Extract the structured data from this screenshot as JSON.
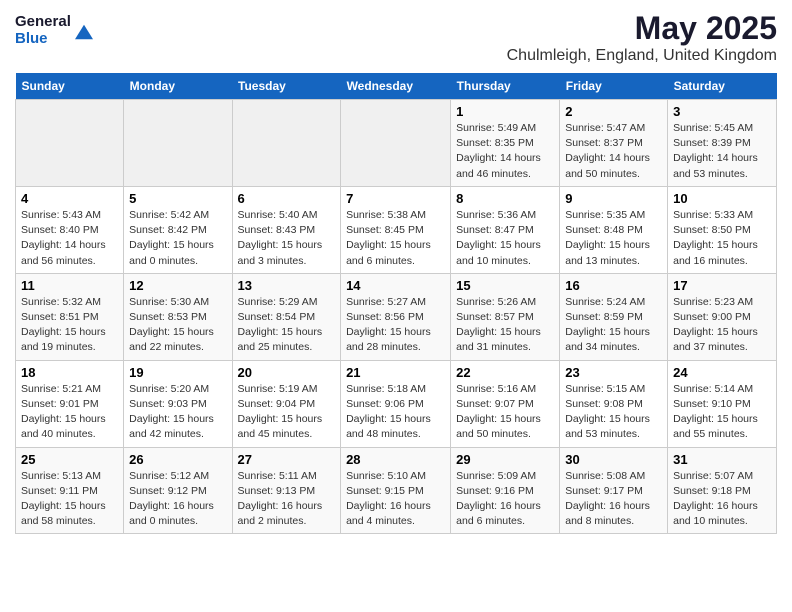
{
  "header": {
    "logo_general": "General",
    "logo_blue": "Blue",
    "title": "May 2025",
    "subtitle": "Chulmleigh, England, United Kingdom"
  },
  "calendar": {
    "days_of_week": [
      "Sunday",
      "Monday",
      "Tuesday",
      "Wednesday",
      "Thursday",
      "Friday",
      "Saturday"
    ],
    "weeks": [
      [
        {
          "day": "",
          "info": ""
        },
        {
          "day": "",
          "info": ""
        },
        {
          "day": "",
          "info": ""
        },
        {
          "day": "",
          "info": ""
        },
        {
          "day": "1",
          "info": "Sunrise: 5:49 AM\nSunset: 8:35 PM\nDaylight: 14 hours\nand 46 minutes."
        },
        {
          "day": "2",
          "info": "Sunrise: 5:47 AM\nSunset: 8:37 PM\nDaylight: 14 hours\nand 50 minutes."
        },
        {
          "day": "3",
          "info": "Sunrise: 5:45 AM\nSunset: 8:39 PM\nDaylight: 14 hours\nand 53 minutes."
        }
      ],
      [
        {
          "day": "4",
          "info": "Sunrise: 5:43 AM\nSunset: 8:40 PM\nDaylight: 14 hours\nand 56 minutes."
        },
        {
          "day": "5",
          "info": "Sunrise: 5:42 AM\nSunset: 8:42 PM\nDaylight: 15 hours\nand 0 minutes."
        },
        {
          "day": "6",
          "info": "Sunrise: 5:40 AM\nSunset: 8:43 PM\nDaylight: 15 hours\nand 3 minutes."
        },
        {
          "day": "7",
          "info": "Sunrise: 5:38 AM\nSunset: 8:45 PM\nDaylight: 15 hours\nand 6 minutes."
        },
        {
          "day": "8",
          "info": "Sunrise: 5:36 AM\nSunset: 8:47 PM\nDaylight: 15 hours\nand 10 minutes."
        },
        {
          "day": "9",
          "info": "Sunrise: 5:35 AM\nSunset: 8:48 PM\nDaylight: 15 hours\nand 13 minutes."
        },
        {
          "day": "10",
          "info": "Sunrise: 5:33 AM\nSunset: 8:50 PM\nDaylight: 15 hours\nand 16 minutes."
        }
      ],
      [
        {
          "day": "11",
          "info": "Sunrise: 5:32 AM\nSunset: 8:51 PM\nDaylight: 15 hours\nand 19 minutes."
        },
        {
          "day": "12",
          "info": "Sunrise: 5:30 AM\nSunset: 8:53 PM\nDaylight: 15 hours\nand 22 minutes."
        },
        {
          "day": "13",
          "info": "Sunrise: 5:29 AM\nSunset: 8:54 PM\nDaylight: 15 hours\nand 25 minutes."
        },
        {
          "day": "14",
          "info": "Sunrise: 5:27 AM\nSunset: 8:56 PM\nDaylight: 15 hours\nand 28 minutes."
        },
        {
          "day": "15",
          "info": "Sunrise: 5:26 AM\nSunset: 8:57 PM\nDaylight: 15 hours\nand 31 minutes."
        },
        {
          "day": "16",
          "info": "Sunrise: 5:24 AM\nSunset: 8:59 PM\nDaylight: 15 hours\nand 34 minutes."
        },
        {
          "day": "17",
          "info": "Sunrise: 5:23 AM\nSunset: 9:00 PM\nDaylight: 15 hours\nand 37 minutes."
        }
      ],
      [
        {
          "day": "18",
          "info": "Sunrise: 5:21 AM\nSunset: 9:01 PM\nDaylight: 15 hours\nand 40 minutes."
        },
        {
          "day": "19",
          "info": "Sunrise: 5:20 AM\nSunset: 9:03 PM\nDaylight: 15 hours\nand 42 minutes."
        },
        {
          "day": "20",
          "info": "Sunrise: 5:19 AM\nSunset: 9:04 PM\nDaylight: 15 hours\nand 45 minutes."
        },
        {
          "day": "21",
          "info": "Sunrise: 5:18 AM\nSunset: 9:06 PM\nDaylight: 15 hours\nand 48 minutes."
        },
        {
          "day": "22",
          "info": "Sunrise: 5:16 AM\nSunset: 9:07 PM\nDaylight: 15 hours\nand 50 minutes."
        },
        {
          "day": "23",
          "info": "Sunrise: 5:15 AM\nSunset: 9:08 PM\nDaylight: 15 hours\nand 53 minutes."
        },
        {
          "day": "24",
          "info": "Sunrise: 5:14 AM\nSunset: 9:10 PM\nDaylight: 15 hours\nand 55 minutes."
        }
      ],
      [
        {
          "day": "25",
          "info": "Sunrise: 5:13 AM\nSunset: 9:11 PM\nDaylight: 15 hours\nand 58 minutes."
        },
        {
          "day": "26",
          "info": "Sunrise: 5:12 AM\nSunset: 9:12 PM\nDaylight: 16 hours\nand 0 minutes."
        },
        {
          "day": "27",
          "info": "Sunrise: 5:11 AM\nSunset: 9:13 PM\nDaylight: 16 hours\nand 2 minutes."
        },
        {
          "day": "28",
          "info": "Sunrise: 5:10 AM\nSunset: 9:15 PM\nDaylight: 16 hours\nand 4 minutes."
        },
        {
          "day": "29",
          "info": "Sunrise: 5:09 AM\nSunset: 9:16 PM\nDaylight: 16 hours\nand 6 minutes."
        },
        {
          "day": "30",
          "info": "Sunrise: 5:08 AM\nSunset: 9:17 PM\nDaylight: 16 hours\nand 8 minutes."
        },
        {
          "day": "31",
          "info": "Sunrise: 5:07 AM\nSunset: 9:18 PM\nDaylight: 16 hours\nand 10 minutes."
        }
      ]
    ]
  }
}
